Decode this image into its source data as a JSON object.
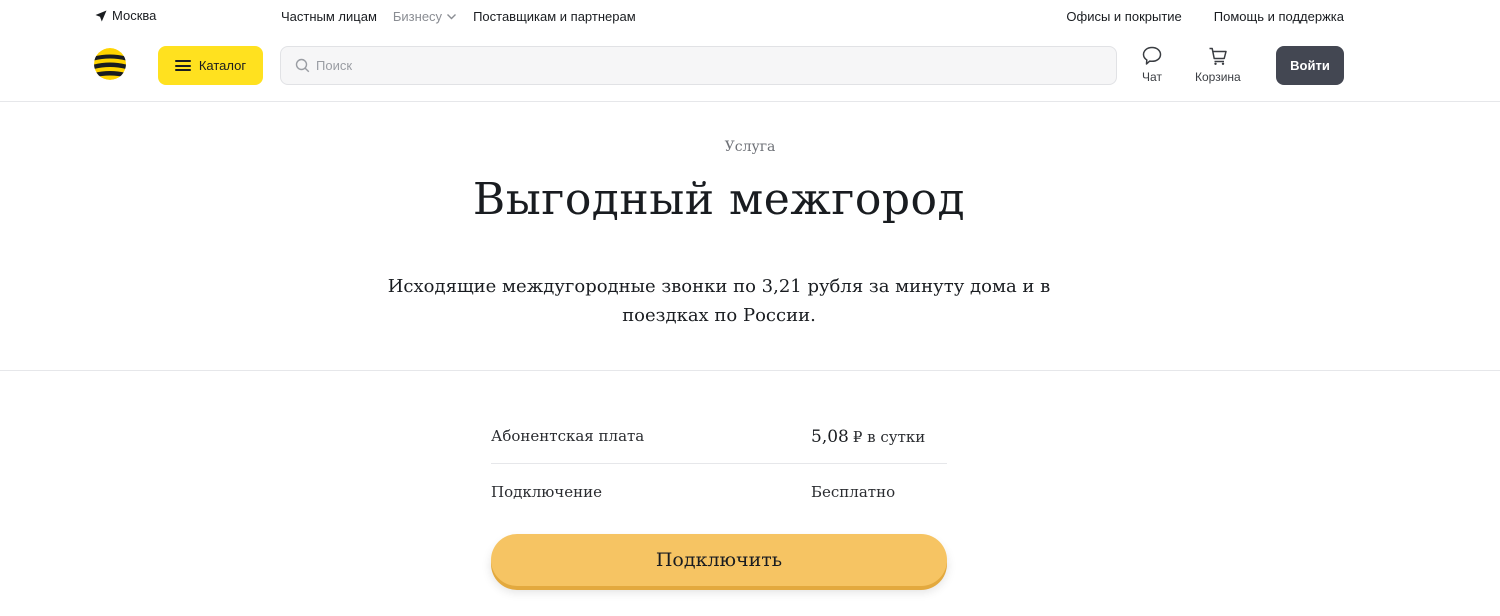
{
  "topbar": {
    "city": "Москва",
    "segments": [
      {
        "label": "Частным лицам"
      },
      {
        "label": "Бизнесу"
      },
      {
        "label": "Поставщикам и партнерам"
      }
    ],
    "links": [
      {
        "label": "Офисы и покрытие"
      },
      {
        "label": "Помощь и поддержка"
      }
    ]
  },
  "header": {
    "catalog_label": "Каталог",
    "search_placeholder": "Поиск",
    "chat_label": "Чат",
    "cart_label": "Корзина",
    "login_label": "Войти"
  },
  "hero": {
    "eyebrow": "Услуга",
    "title": "Выгодный межгород",
    "description": "Исходящие междугородные звонки по 3,21 рубля за минуту дома и в поездках по России."
  },
  "tariff": {
    "fee_label": "Абонентская плата",
    "fee_amount": "5,08",
    "fee_unit": "₽ в сутки",
    "connection_label": "Подключение",
    "connection_value": "Бесплатно",
    "connect_button": "Подключить"
  },
  "colors": {
    "brand_yellow": "#ffe11f",
    "button_dark": "#434752",
    "connect_button": "#f6c463"
  },
  "icons": [
    "location-arrow-icon",
    "chevron-down-icon",
    "search-icon",
    "chat-icon",
    "cart-icon",
    "beeline-logo"
  ]
}
